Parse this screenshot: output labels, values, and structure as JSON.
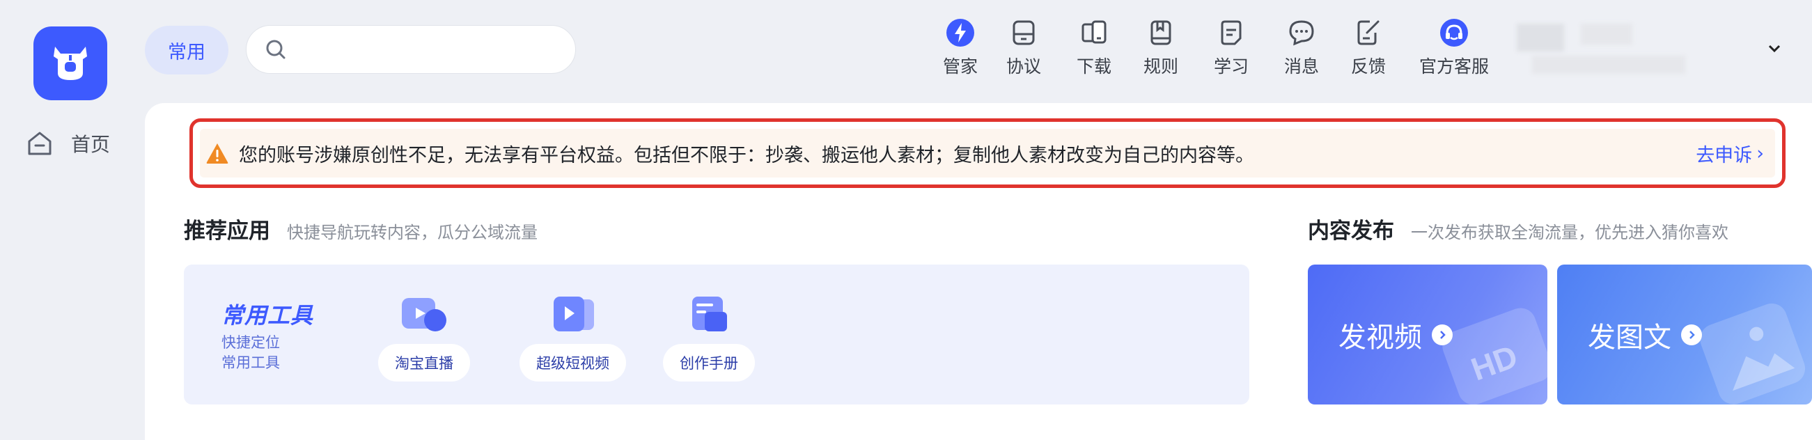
{
  "logo": {
    "icon": "ox-logo-icon"
  },
  "sidebar": {
    "home_label": "首页"
  },
  "header": {
    "chip_label": "常用",
    "search_placeholder": "",
    "nav": [
      {
        "label": "管家",
        "icon": "lightning-icon"
      },
      {
        "label": "协议",
        "icon": "document-icon"
      },
      {
        "label": "下载",
        "icon": "devices-icon"
      },
      {
        "label": "规则",
        "icon": "book-icon"
      },
      {
        "label": "学习",
        "icon": "note-icon"
      },
      {
        "label": "消息",
        "icon": "chat-icon"
      },
      {
        "label": "反馈",
        "icon": "edit-icon"
      },
      {
        "label": "官方客服",
        "icon": "headset-icon"
      }
    ]
  },
  "alert": {
    "text": "您的账号涉嫌原创性不足，无法享有平台权益。包括但不限于：抄袭、搬运他人素材；复制他人素材改变为自己的内容等。",
    "link": "去申诉",
    "link_arrow": "›",
    "accent": "#e0332d"
  },
  "recommended": {
    "title": "推荐应用",
    "subtitle": "快捷导航玩转内容，瓜分公域流量",
    "tools": {
      "title": "常用工具",
      "sub1": "快捷定位",
      "sub2": "常用工具",
      "apps": [
        {
          "label": "淘宝直播",
          "icon": "live-camera-icon"
        },
        {
          "label": "超级短视频",
          "icon": "video-icon"
        },
        {
          "label": "创作手册",
          "icon": "handbook-icon"
        }
      ]
    }
  },
  "publish": {
    "title": "内容发布",
    "subtitle": "一次发布获取全淘流量，优先进入猜你喜欢",
    "cards": [
      {
        "label": "发视频",
        "deco": "HD"
      },
      {
        "label": "发图文"
      }
    ]
  },
  "colors": {
    "brand": "#3d5afe",
    "bg": "#eef0f5"
  }
}
